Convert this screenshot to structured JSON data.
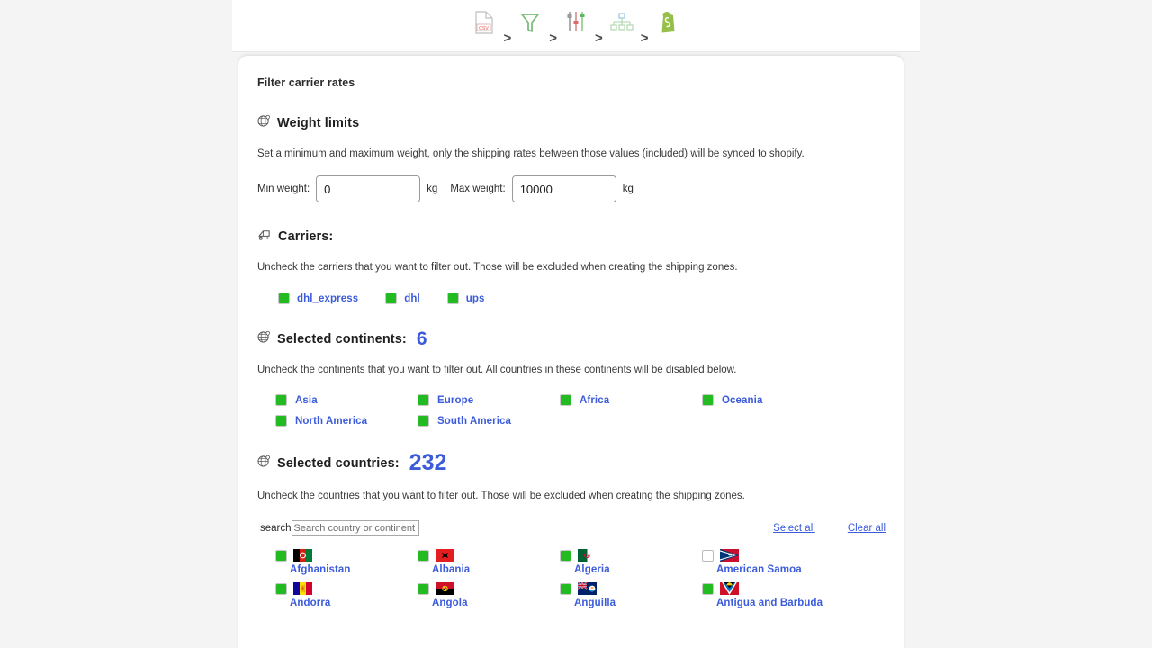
{
  "toolbar": {
    "steps": [
      {
        "icon": "csv-file-icon",
        "name": "csv-file"
      },
      {
        "sep": ">"
      },
      {
        "icon": "funnel-filter-icon",
        "name": "filter"
      },
      {
        "sep": ">"
      },
      {
        "icon": "sliders-icon",
        "name": "adjust"
      },
      {
        "sep": ">"
      },
      {
        "icon": "hierarchy-tree-icon",
        "name": "zones"
      },
      {
        "sep": ">"
      },
      {
        "icon": "shopify-bag-icon",
        "name": "shopify"
      }
    ]
  },
  "page": {
    "title": "Filter carrier rates"
  },
  "weight": {
    "heading": "Weight limits",
    "icon": "globe-pin-icon",
    "description": "Set a minimum and maximum weight, only the shipping rates between those values (included) will be synced to shopify.",
    "min_label": "Min weight:",
    "min_value": "0",
    "min_unit": "kg",
    "max_label": "Max weight:",
    "max_value": "10000",
    "max_unit": "kg"
  },
  "carriers": {
    "heading": "Carriers:",
    "icon": "truck-icon",
    "description": "Uncheck the carriers that you want to filter out. Those will be excluded when creating the shipping zones.",
    "items": [
      {
        "label": "dhl_express",
        "checked": true
      },
      {
        "label": "dhl",
        "checked": true
      },
      {
        "label": "ups",
        "checked": true
      }
    ]
  },
  "continents": {
    "heading": "Selected continents:",
    "icon": "globe-pin-icon",
    "count": "6",
    "description": "Uncheck the continents that you want to filter out. All countries in these continents will be disabled below.",
    "items": [
      {
        "label": "Asia",
        "checked": true
      },
      {
        "label": "Europe",
        "checked": true
      },
      {
        "label": "Africa",
        "checked": true
      },
      {
        "label": "Oceania",
        "checked": true
      },
      {
        "label": "North America",
        "checked": true
      },
      {
        "label": "South America",
        "checked": true
      }
    ]
  },
  "countries": {
    "heading": "Selected countries:",
    "icon": "globe-pin-icon",
    "count": "232",
    "description": "Uncheck the countries that you want to filter out. Those will be excluded when creating the shipping zones.",
    "search_label": "search",
    "search_placeholder": "Search country or continent",
    "search_value": "",
    "select_all_label": "Select all",
    "clear_all_label": "Clear all",
    "items": [
      {
        "label": "Afghanistan",
        "checked": true,
        "flag": "af"
      },
      {
        "label": "Albania",
        "checked": true,
        "flag": "al"
      },
      {
        "label": "Algeria",
        "checked": true,
        "flag": "dz"
      },
      {
        "label": "American Samoa",
        "checked": false,
        "flag": "as"
      },
      {
        "label": "Andorra",
        "checked": true,
        "flag": "ad"
      },
      {
        "label": "Angola",
        "checked": true,
        "flag": "ao"
      },
      {
        "label": "Anguilla",
        "checked": true,
        "flag": "ai"
      },
      {
        "label": "Antigua and Barbuda",
        "checked": true,
        "flag": "ag"
      }
    ]
  },
  "colors": {
    "accent_blue": "#3b5bdb",
    "checkbox_green": "#22bb22",
    "page_bg": "#f4f4f4",
    "card_bg": "#ffffff"
  }
}
